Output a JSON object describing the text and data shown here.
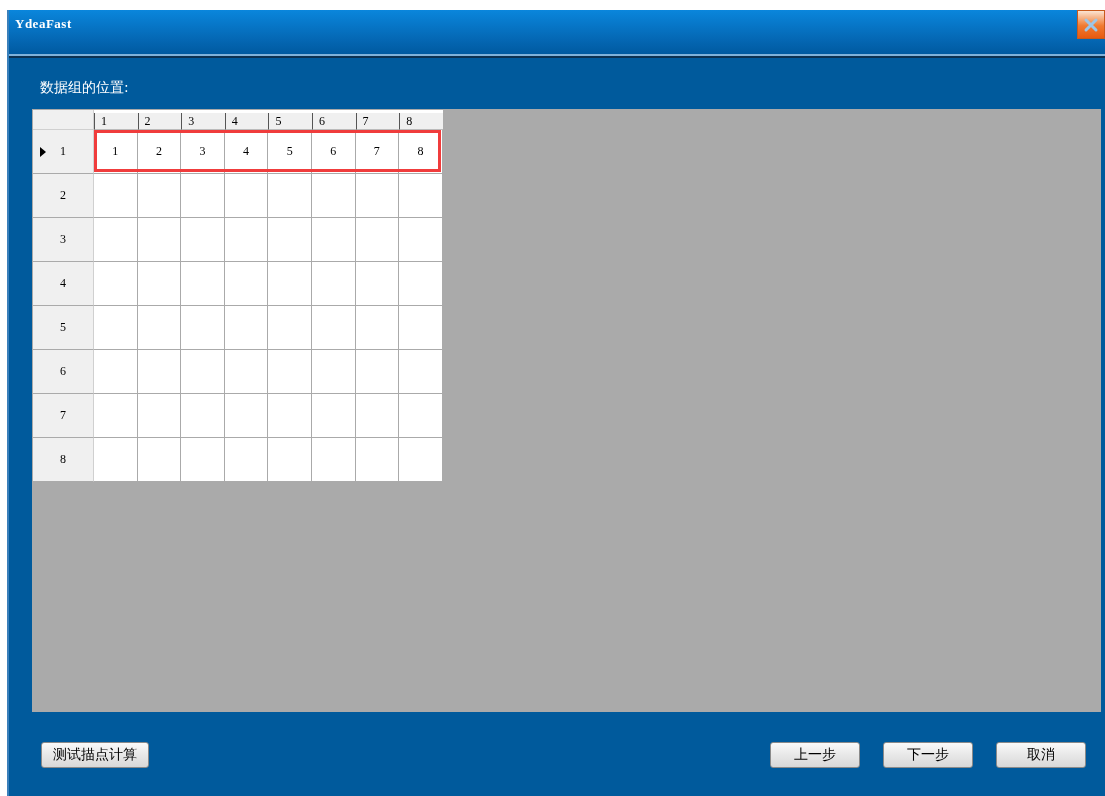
{
  "window": {
    "title": "YdeaFast"
  },
  "label": "数据组的位置:",
  "grid": {
    "columns": [
      "1",
      "2",
      "3",
      "4",
      "5",
      "6",
      "7",
      "8"
    ],
    "rows": [
      {
        "label": "1",
        "current": true,
        "selected": true,
        "cells": [
          "1",
          "2",
          "3",
          "4",
          "5",
          "6",
          "7",
          "8"
        ]
      },
      {
        "label": "2",
        "current": false,
        "selected": false
      },
      {
        "label": "3",
        "current": false,
        "selected": false
      },
      {
        "label": "4",
        "current": false,
        "selected": false
      },
      {
        "label": "5",
        "current": false,
        "selected": false
      },
      {
        "label": "6",
        "current": false,
        "selected": false
      },
      {
        "label": "7",
        "current": false,
        "selected": false
      },
      {
        "label": "8",
        "current": false,
        "selected": false
      }
    ]
  },
  "left_buttons": [
    "测试描点计算"
  ],
  "right_buttons": [
    "上一步",
    "下一步",
    "取消"
  ]
}
